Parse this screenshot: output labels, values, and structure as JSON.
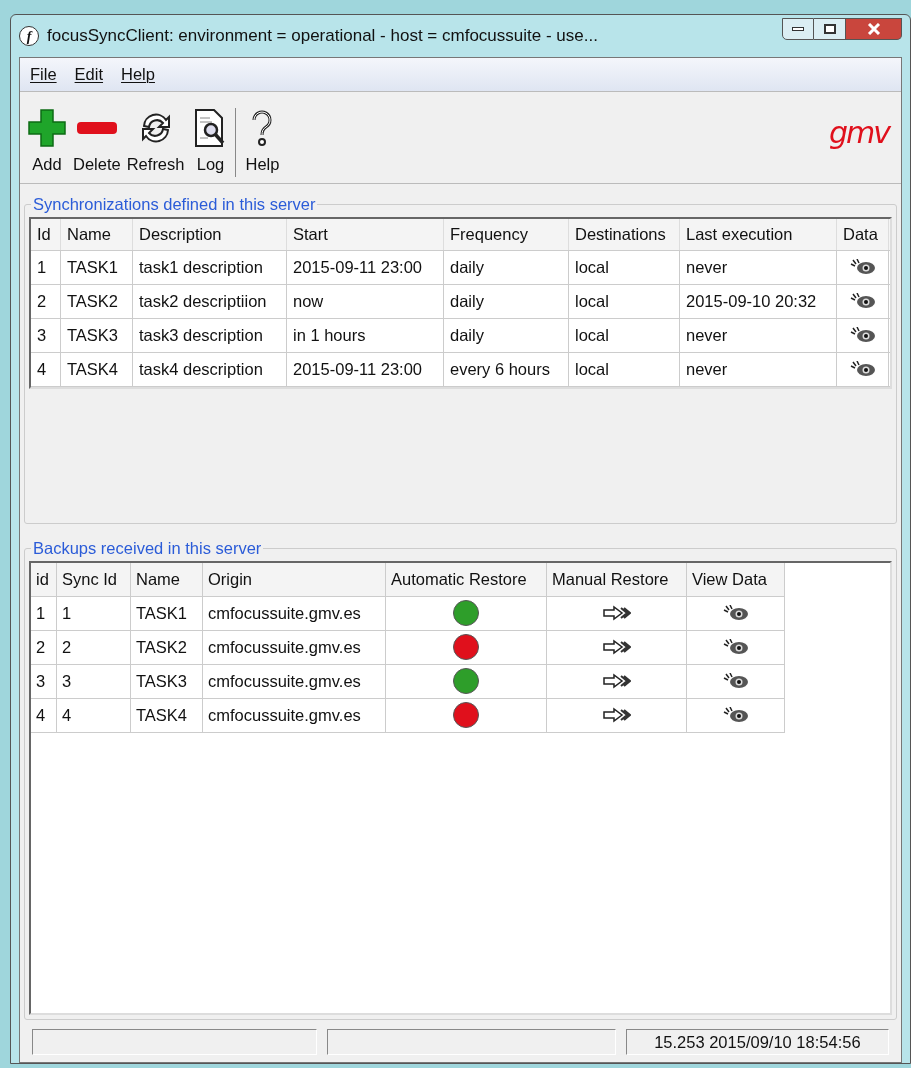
{
  "window": {
    "icon_letter": "f",
    "title": "focusSyncClient: environment = operational  - host = cmfocussuite  - use..."
  },
  "menu": [
    {
      "label": "File"
    },
    {
      "label": "Edit"
    },
    {
      "label": "Help"
    }
  ],
  "toolbar": [
    {
      "kind": "add",
      "label": "Add"
    },
    {
      "kind": "delete",
      "label": "Delete"
    },
    {
      "kind": "refresh",
      "label": "Refresh"
    },
    {
      "kind": "log",
      "label": "Log"
    },
    {
      "kind": "help",
      "label": "Help"
    }
  ],
  "logo": "gmv",
  "synchronizations": {
    "title": "Synchronizations defined in this server",
    "columns": [
      "Id",
      "Name",
      "Description",
      "Start",
      "Frequency",
      "Destinations",
      "Last execution",
      "Data"
    ],
    "rows": [
      {
        "id": "1",
        "name": "TASK1",
        "description": "task1 description",
        "start": "2015-09-11 23:00",
        "frequency": "daily",
        "destinations": "local",
        "last_execution": "never"
      },
      {
        "id": "2",
        "name": "TASK2",
        "description": "task2 descriptiion",
        "start": "now",
        "frequency": "daily",
        "destinations": "local",
        "last_execution": "2015-09-10 20:32"
      },
      {
        "id": "3",
        "name": "TASK3",
        "description": "task3 description",
        "start": "in 1 hours",
        "frequency": "daily",
        "destinations": "local",
        "last_execution": "never"
      },
      {
        "id": "4",
        "name": "TASK4",
        "description": "task4 description",
        "start": "2015-09-11 23:00",
        "frequency": "every 6 hours",
        "destinations": "local",
        "last_execution": "never"
      }
    ]
  },
  "backups": {
    "title": "Backups received in this server",
    "columns": [
      "id",
      "Sync Id",
      "Name",
      "Origin",
      "Automatic Restore",
      "Manual Restore",
      "View Data"
    ],
    "rows": [
      {
        "id": "1",
        "sync_id": "1",
        "name": "TASK1",
        "origin": "cmfocussuite.gmv.es",
        "color": "#2e9e2a"
      },
      {
        "id": "2",
        "sync_id": "2",
        "name": "TASK2",
        "origin": "cmfocussuite.gmv.es",
        "color": "#e0101c"
      },
      {
        "id": "3",
        "sync_id": "3",
        "name": "TASK3",
        "origin": "cmfocussuite.gmv.es",
        "color": "#2e9e2a"
      },
      {
        "id": "4",
        "sync_id": "4",
        "name": "TASK4",
        "origin": "cmfocussuite.gmv.es",
        "color": "#e0101c"
      }
    ]
  },
  "status_bar": {
    "text": "15.253 2015/09/10 18:54:56"
  }
}
